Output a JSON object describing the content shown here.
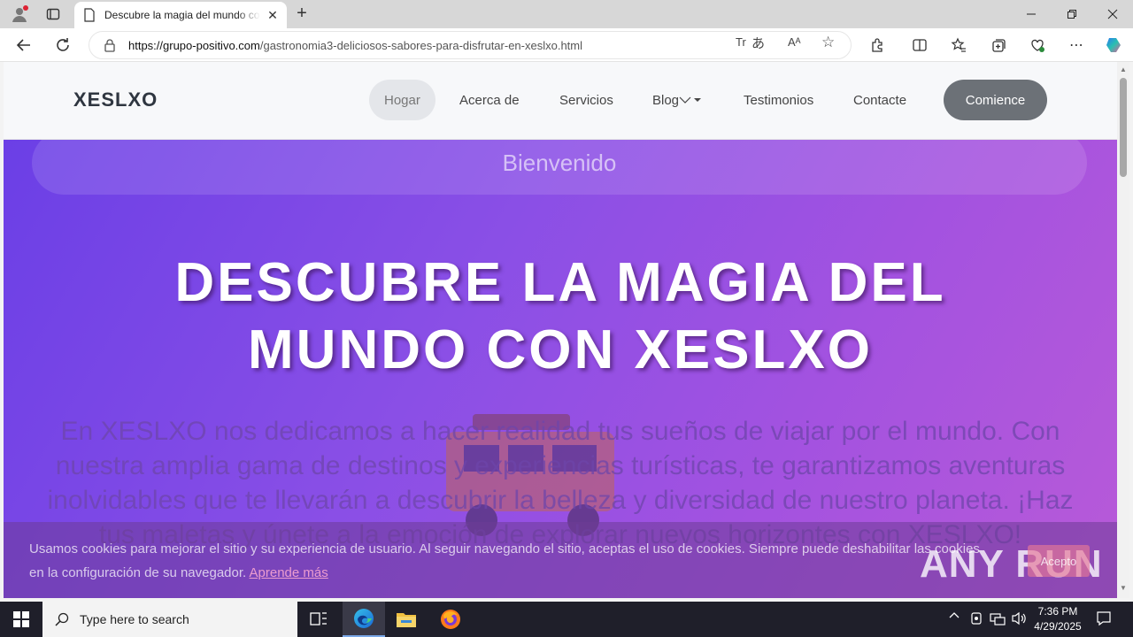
{
  "browser": {
    "tab_title": "Descubre la magia del mundo con XESLXO",
    "url_domain": "https://grupo-positivo.com",
    "url_path": "/gastronomia3-deliciosos-sabores-para-disfrutar-en-xeslxo.html",
    "addr_translate_label": "Tr",
    "addr_read_label": "Aᴬ"
  },
  "site": {
    "logo": "XESLXO",
    "menu": [
      {
        "label": "Hogar",
        "active": true
      },
      {
        "label": "Acerca de"
      },
      {
        "label": "Servicios"
      },
      {
        "label": "Blog"
      },
      {
        "label": "Testimonios"
      },
      {
        "label": "Contacte"
      }
    ],
    "cta_label": "Comience"
  },
  "hero": {
    "welcome": "Bienvenido",
    "title_line1": "DESCUBRE LA MAGIA DEL",
    "title_line2": "MUNDO CON XESLXO",
    "text": "En XESLXO nos dedicamos a hacer realidad tus sueños de viajar por el mundo. Con nuestra amplia gama de destinos y experiencias turísticas, te garantizamos aventuras inolvidables que te llevarán a descubrir la belleza y diversidad de nuestro planeta. ¡Haz tus maletas y únete a la emoción de explorar nuevos horizontes con XESLXO!"
  },
  "cookie": {
    "text": "Usamos cookies para mejorar el sitio y su experiencia de usuario. Al seguir navegando el sitio, aceptas el uso de cookies. Siempre puede deshabilitar las cookies en la configuración de su navegador.",
    "link": "Aprende más",
    "button": "Acepto"
  },
  "watermark": "ANY RUN",
  "taskbar": {
    "search_placeholder": "Type here to search",
    "time": "7:36 PM",
    "date": "4/29/2025"
  }
}
